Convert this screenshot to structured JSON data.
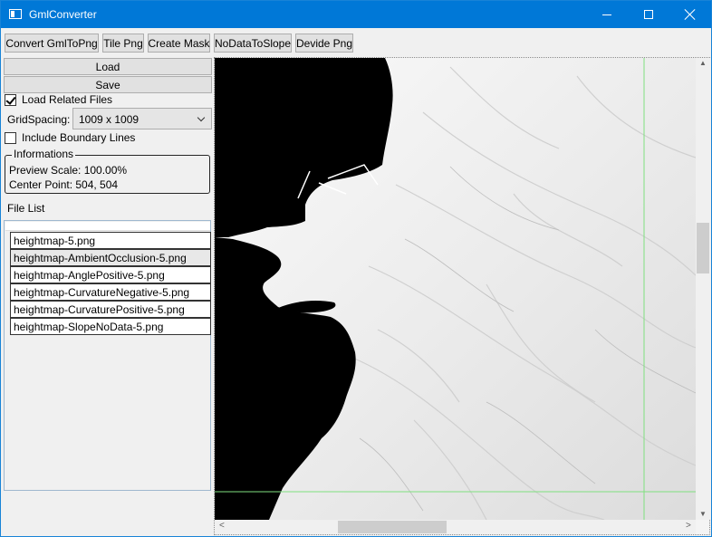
{
  "window": {
    "title": "GmlConverter"
  },
  "toolbar": {
    "convert_label": "Convert GmlToPng",
    "tile_label": "Tile Png",
    "mask_label": "Create Mask",
    "nodata_label": "NoDataToSlope",
    "divide_label": "Devide Png"
  },
  "left": {
    "load_label": "Load",
    "save_label": "Save",
    "load_related": {
      "label": "Load Related Files",
      "checked": true
    },
    "grid_spacing": {
      "label": "GridSpacing:",
      "value": "1009 x 1009"
    },
    "include_boundary": {
      "label": "Include Boundary Lines",
      "checked": false
    },
    "info": {
      "legend": "Informations",
      "preview_scale": "Preview Scale:  100.00%",
      "center_point": "Center Point:  504, 504"
    },
    "file_list": {
      "label": "File List",
      "items": [
        "heightmap-5.png",
        "heightmap-AmbientOcclusion-5.png",
        "heightmap-AnglePositive-5.png",
        "heightmap-CurvatureNegative-5.png",
        "heightmap-CurvaturePositive-5.png",
        "heightmap-SlopeNoData-5.png"
      ],
      "selected_index": 1
    }
  },
  "preview": {
    "guide_color": "#7fe07f",
    "scroll_up": "▲",
    "scroll_down": "▼",
    "scroll_left": "<",
    "scroll_right": ">"
  }
}
